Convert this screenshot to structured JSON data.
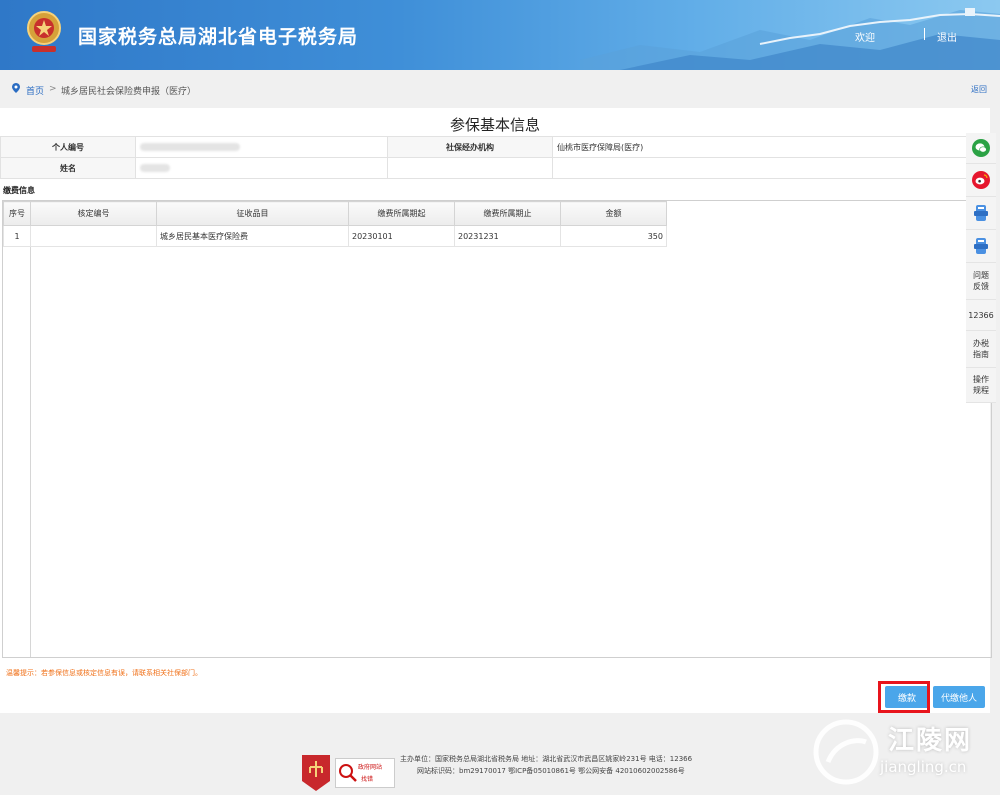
{
  "header": {
    "title": "国家税务总局湖北省电子税务局",
    "welcome": "欢迎",
    "logout": "退出"
  },
  "breadcrumb": {
    "home": "首页",
    "separator": ">",
    "current": "城乡居民社会保险费申报（医疗）",
    "back": "返回"
  },
  "page_title": "参保基本信息",
  "info": {
    "id_label": "个人编号",
    "agency_label": "社保经办机构",
    "agency_value": "仙桃市医疗保障局(医疗)",
    "name_label": "姓名"
  },
  "section_label": "缴费信息",
  "grid": {
    "columns": [
      "序号",
      "核定编号",
      "征收品目",
      "缴费所属期起",
      "缴费所属期止",
      "金额"
    ],
    "rows": [
      [
        "1",
        "",
        "城乡居民基本医疗保险费",
        "20230101",
        "20231231",
        "350"
      ]
    ]
  },
  "warm_tip": "温馨提示：若参保信息或核定信息有误，请联系相关社保部门。",
  "buttons": {
    "pay": "缴款",
    "pay_for_others": "代缴他人"
  },
  "sidebar": {
    "items": [
      {
        "icon": "wechat-icon"
      },
      {
        "icon": "weibo-icon"
      },
      {
        "icon": "app-icon"
      },
      {
        "icon": "app-icon"
      },
      {
        "label": "问题反馈"
      },
      {
        "label": "12366"
      },
      {
        "label": "办税指南"
      },
      {
        "label": "操作规程"
      }
    ]
  },
  "footer": {
    "line1": "主办单位：国家税务总局湖北省税务局   地址：湖北省武汉市武昌区姚家岭231号  电话：12366",
    "line2": "网站标识码：bm29170017   鄂ICP备05010861号   鄂公网安备 42010602002586号",
    "gov_badge_line1": "政府网站",
    "gov_badge_line2": "找错"
  },
  "watermark": {
    "brand": "江陵网",
    "domain": "jiangling.cn"
  },
  "colors": {
    "header_blue": "#2f78c8",
    "button_blue": "#4aa6ea",
    "tip_orange": "#f07018",
    "highlight_red": "#e8141c",
    "link_blue": "#2a6cc2"
  }
}
